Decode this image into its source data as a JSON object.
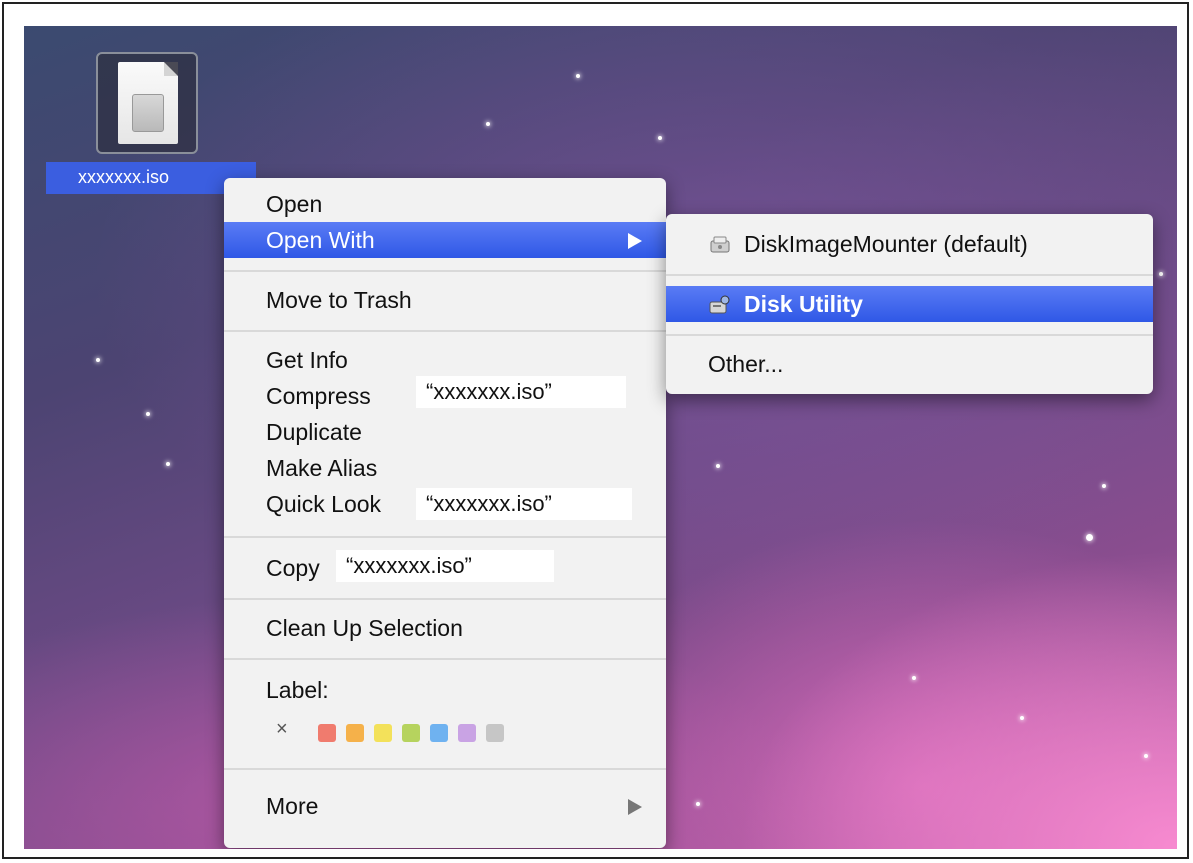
{
  "file": {
    "name": "xxxxxxx.iso",
    "icon": "disk-image-file-icon"
  },
  "context_menu": {
    "open": "Open",
    "open_with": "Open With",
    "move_to_trash": "Move to Trash",
    "get_info": "Get Info",
    "compress": "Compress",
    "compress_target": "“xxxxxxx.iso”",
    "duplicate": "Duplicate",
    "make_alias": "Make Alias",
    "quick_look": "Quick Look",
    "quick_look_target": "“xxxxxxx.iso”",
    "copy": "Copy",
    "copy_target": "“xxxxxxx.iso”",
    "clean_up": "Clean Up Selection",
    "label_heading": "Label:",
    "label_clear": "×",
    "label_colors": [
      "#f07b6e",
      "#f5b14a",
      "#f3e15a",
      "#b6d35e",
      "#6fb2f0",
      "#c9a3e4",
      "#c6c6c6"
    ],
    "more": "More"
  },
  "open_with_submenu": {
    "diskimagemounter": "DiskImageMounter (default)",
    "disk_utility": "Disk Utility",
    "other": "Other..."
  },
  "colors": {
    "highlight": "#3b63e8",
    "selection_label": "#3b5ee0"
  }
}
